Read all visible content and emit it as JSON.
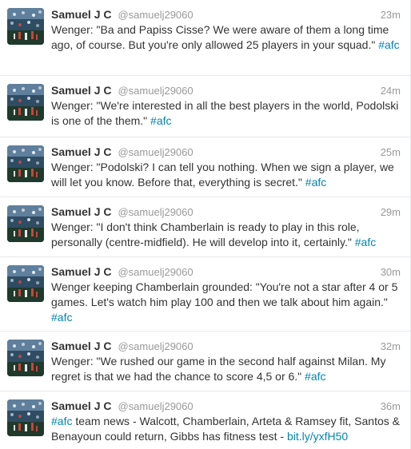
{
  "tweets": [
    {
      "name": "Samuel J C",
      "handle": "@samuelj29060",
      "time": "23m",
      "text": "Wenger: \"Ba and Papiss Cisse? We were aware of them a long time ago, of course. But you're only allowed 25 players in your squad.\"",
      "hashtag_lead": "",
      "hashtag_tail": "#afc",
      "link": ""
    },
    {
      "name": "Samuel J C",
      "handle": "@samuelj29060",
      "time": "24m",
      "text": "Wenger: \"We're interested in all the best players in the world, Podolski is one of the them.\"",
      "hashtag_lead": "",
      "hashtag_tail": "#afc",
      "link": ""
    },
    {
      "name": "Samuel J C",
      "handle": "@samuelj29060",
      "time": "25m",
      "text": "Wenger: \"Podolski? I can tell you nothing. When we sign a player, we will let you know. Before that, everything is secret.\"",
      "hashtag_lead": "",
      "hashtag_tail": "#afc",
      "link": ""
    },
    {
      "name": "Samuel J C",
      "handle": "@samuelj29060",
      "time": "29m",
      "text": "Wenger: \"I don't think Chamberlain is ready to play in this role, personally (centre-midfield). He will develop into it, certainly.\"",
      "hashtag_lead": "",
      "hashtag_tail": "#afc",
      "link": ""
    },
    {
      "name": "Samuel J C",
      "handle": "@samuelj29060",
      "time": "30m",
      "text": "Wenger keeping Chamberlain grounded: \"You're not a star after 4 or 5 games. Let's watch him play 100 and then we talk about him again.\"",
      "hashtag_lead": "",
      "hashtag_tail": "#afc",
      "link": ""
    },
    {
      "name": "Samuel J C",
      "handle": "@samuelj29060",
      "time": "32m",
      "text": "Wenger: \"We rushed our game in the second half against Milan. My regret is that we had the chance to score 4,5 or 6.\"",
      "hashtag_lead": "",
      "hashtag_tail": "#afc",
      "link": ""
    },
    {
      "name": "Samuel J C",
      "handle": "@samuelj29060",
      "time": "36m",
      "text": "team news - Walcott, Chamberlain, Arteta & Ramsey fit, Santos & Benayoun could return, Gibbs has fitness test -",
      "hashtag_lead": "#afc",
      "hashtag_tail": "",
      "link": "bit.ly/yxfH50"
    }
  ],
  "colors": {
    "link": "#0084b4",
    "name": "#333333",
    "meta": "#999999"
  }
}
